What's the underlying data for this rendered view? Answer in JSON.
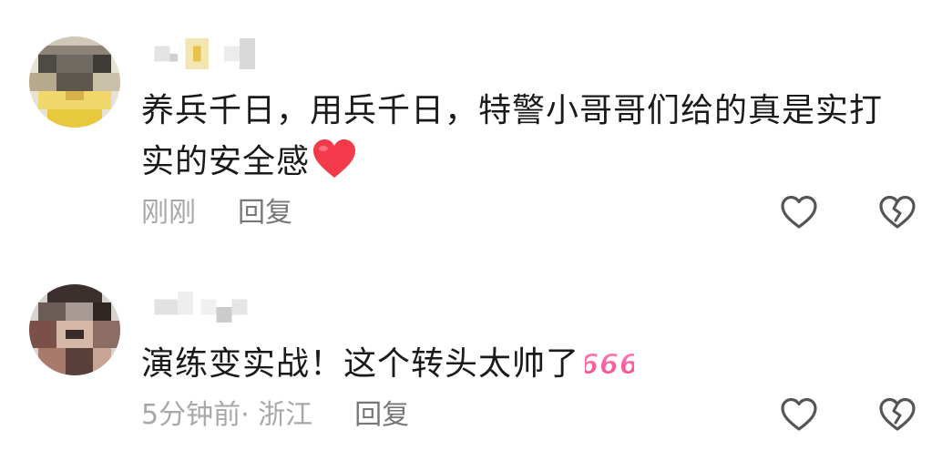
{
  "comments": [
    {
      "text": "养兵千日，用兵千日，特警小哥哥们给的真是实打实的安全感",
      "time": "刚刚",
      "location": "",
      "reply_label": "回复",
      "emoji": "red-heart-emoji"
    },
    {
      "text": "演练变实战！这个转头太帅了",
      "time": "5分钟前",
      "location": "· 浙江",
      "reply_label": "回复",
      "emoji": "666-emoji",
      "emoji_text": "666"
    }
  ],
  "colors": {
    "text": "#1a1a1a",
    "meta": "#a8a8a8",
    "reply": "#777777",
    "icon": "#555555",
    "heart": "#f23a4a",
    "emoji_666": "#ff4f9a"
  },
  "icons": [
    "like-icon",
    "dislike-icon"
  ]
}
